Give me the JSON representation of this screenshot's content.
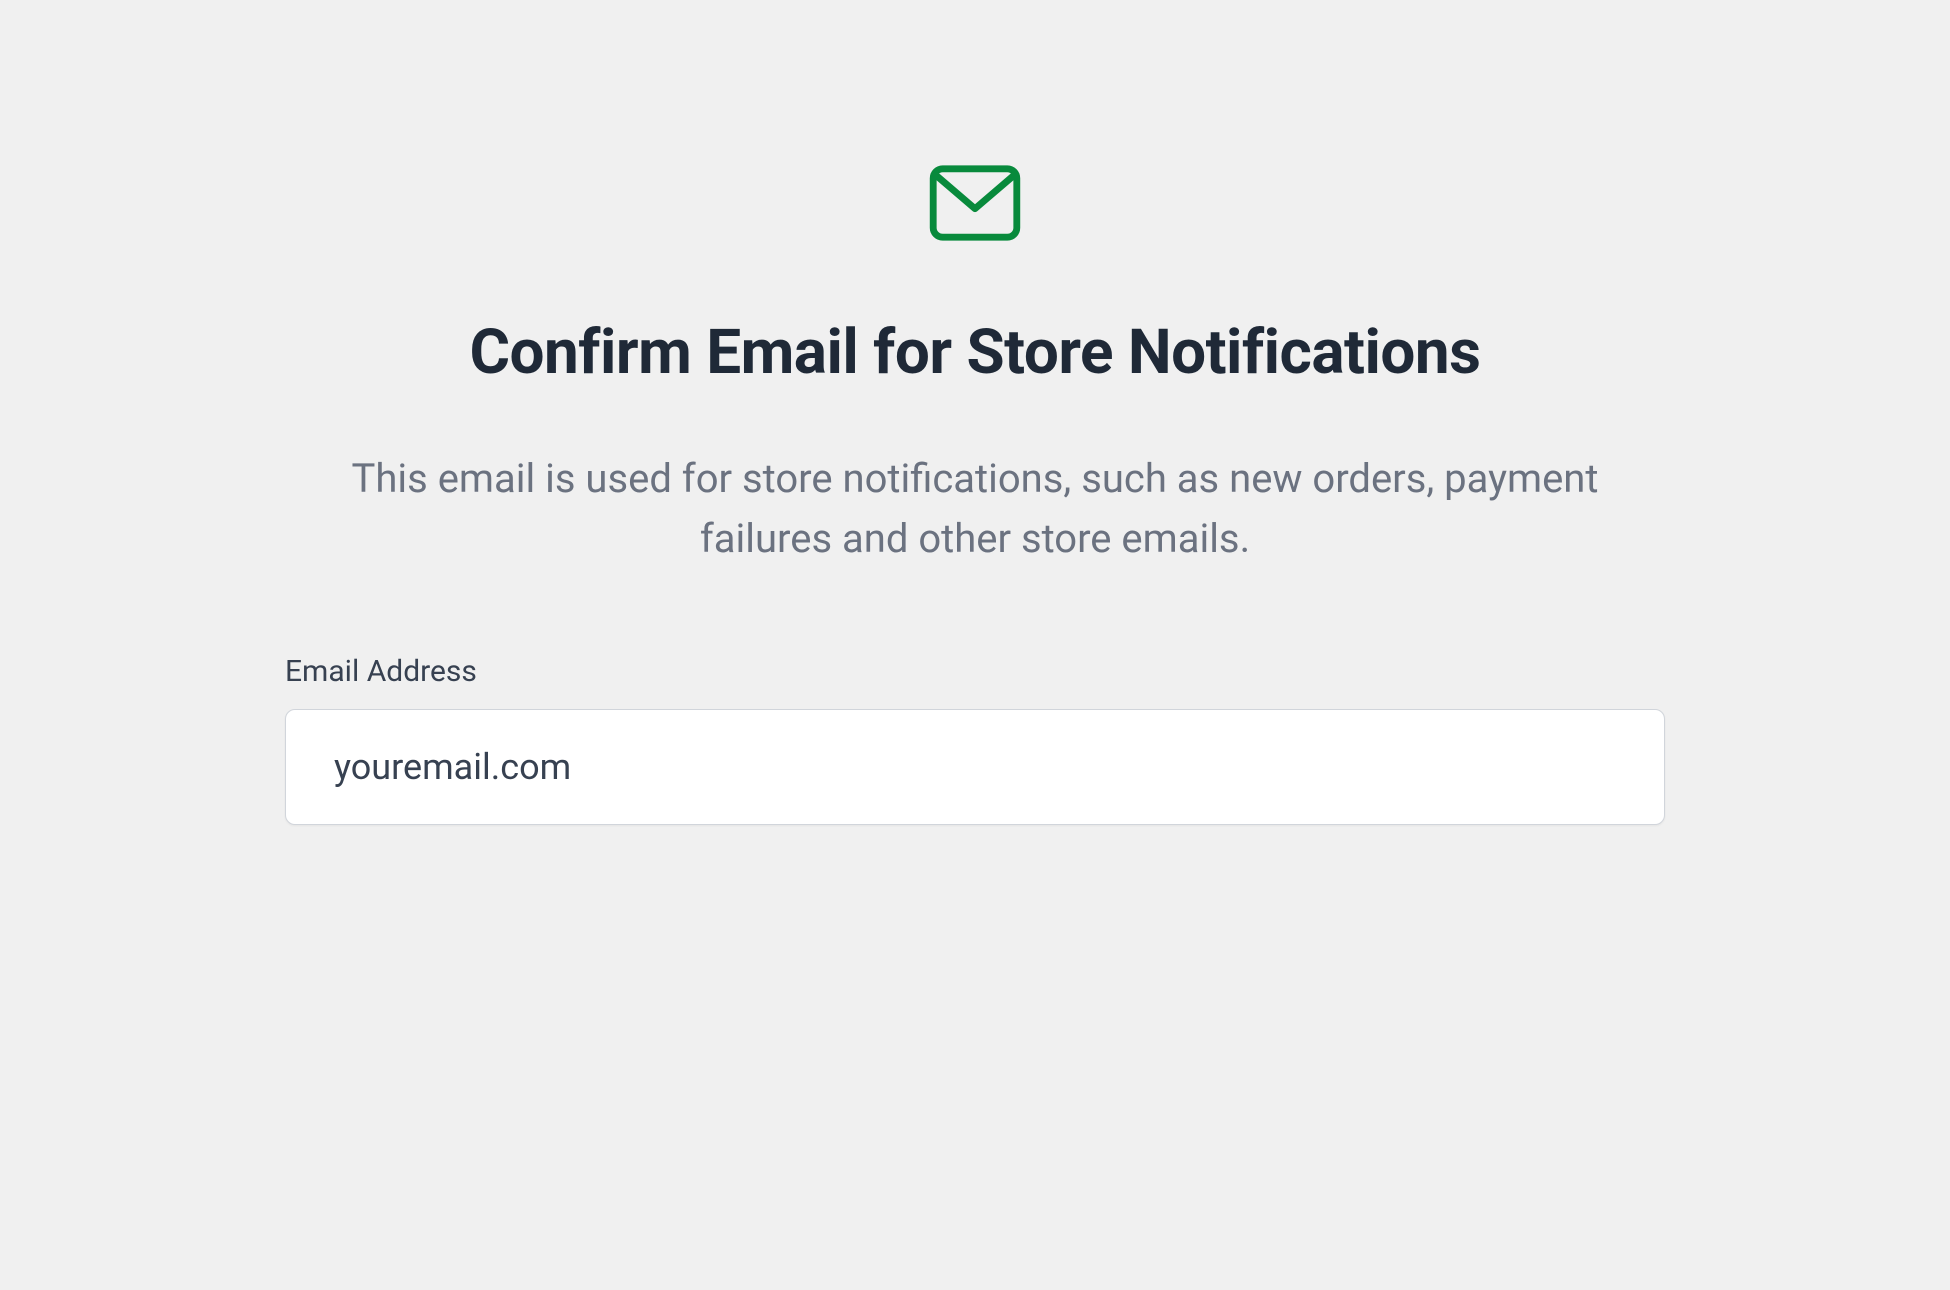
{
  "icon": "mail-icon",
  "colors": {
    "accent": "#088a3c",
    "background": "#f0f0f0",
    "text_primary": "#1f2937",
    "text_secondary": "#6b7280",
    "text_label": "#374151",
    "input_border": "#d1d5db",
    "input_background": "#ffffff"
  },
  "header": {
    "title": "Confirm Email for Store Notifications",
    "description": "This email is used for store notifications, such as new orders, payment failures and other store emails."
  },
  "form": {
    "email": {
      "label": "Email Address",
      "value": "youremail.com",
      "placeholder": ""
    }
  }
}
